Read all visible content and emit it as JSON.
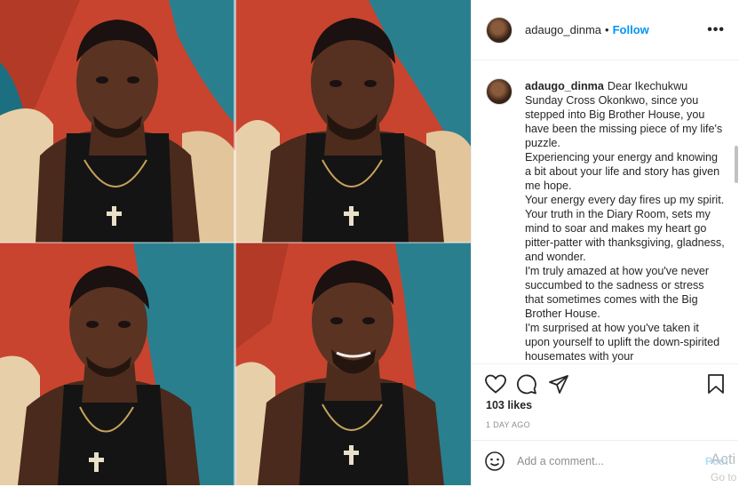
{
  "post": {
    "username": "adaugo_dinma",
    "separator": "•",
    "follow_label": "Follow",
    "more_label": "•••"
  },
  "caption": {
    "author": "adaugo_dinma",
    "text": "Dear Ikechukwu Sunday Cross Okonkwo, since you stepped into Big Brother House, you have been the missing piece of my life's puzzle.\nExperiencing your energy and knowing a bit about your life and story has given me hope.\nYour energy every day fires up my spirit. Your truth in the Diary Room, sets my mind to soar and makes my heart go pitter-patter with thanksgiving, gladness, and wonder.\nI'm truly amazed at how you've never succumbed to the sadness or stress that sometimes comes with the Big Brother House.\nI'm surprised at how you've taken it upon yourself to uplift the down-spirited housemates with your"
  },
  "actions": {
    "like_icon": "heart-outline-icon",
    "comment_icon": "speech-bubble-icon",
    "share_icon": "paper-plane-icon",
    "save_icon": "bookmark-icon"
  },
  "likes": "103 likes",
  "time_ago": "1 DAY AGO",
  "comment_box": {
    "emoji_icon": "smiley-icon",
    "placeholder": "Add a comment...",
    "post_label": "Post"
  },
  "os_watermark": {
    "line1": "Acti",
    "line2": "Go to"
  },
  "colors": {
    "accent_blue": "#0095f6",
    "text": "#262626",
    "muted": "#8e8e8e",
    "border": "#efefef",
    "background_red": "#c0392b",
    "background_teal": "#1f7a8c"
  }
}
